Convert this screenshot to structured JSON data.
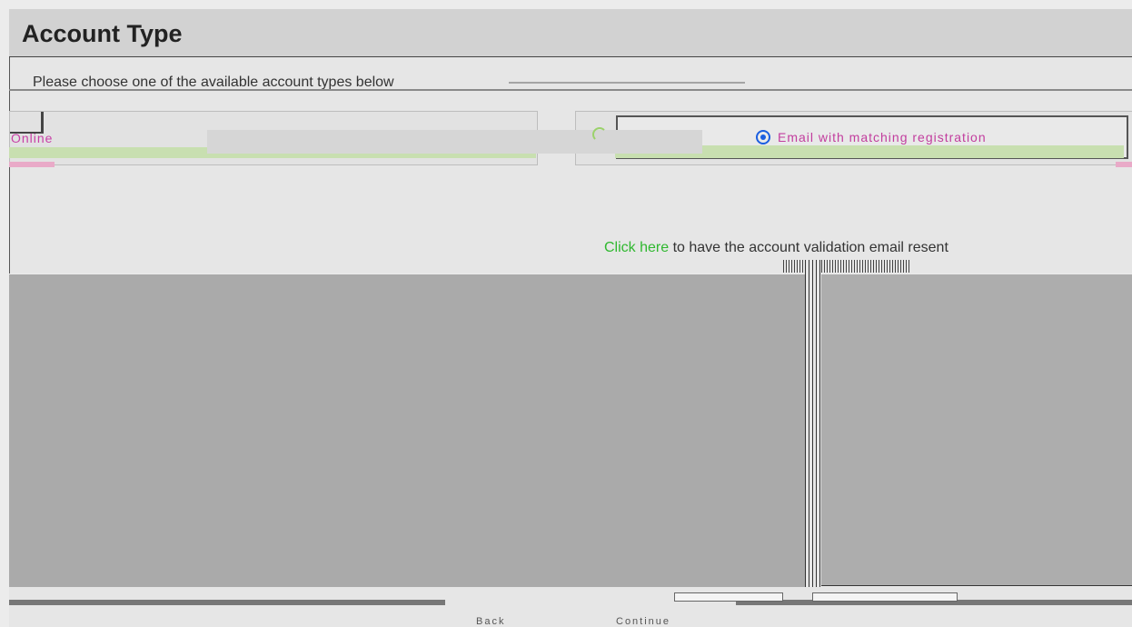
{
  "header": {
    "title": "Account Type"
  },
  "intro": {
    "text": "Please choose one of the available account types below"
  },
  "options": {
    "left_label": "Online",
    "right_label": "Email with matching registration"
  },
  "notice": {
    "link_text": "Click here",
    "rest_text": " to have the account validation email resent"
  },
  "footer": {
    "left_label": "Back",
    "right_label": "Continue"
  },
  "colors": {
    "accent_green": "#2fb82f",
    "option_pink": "#c83fa6",
    "radio_blue": "#1a5ee0"
  }
}
